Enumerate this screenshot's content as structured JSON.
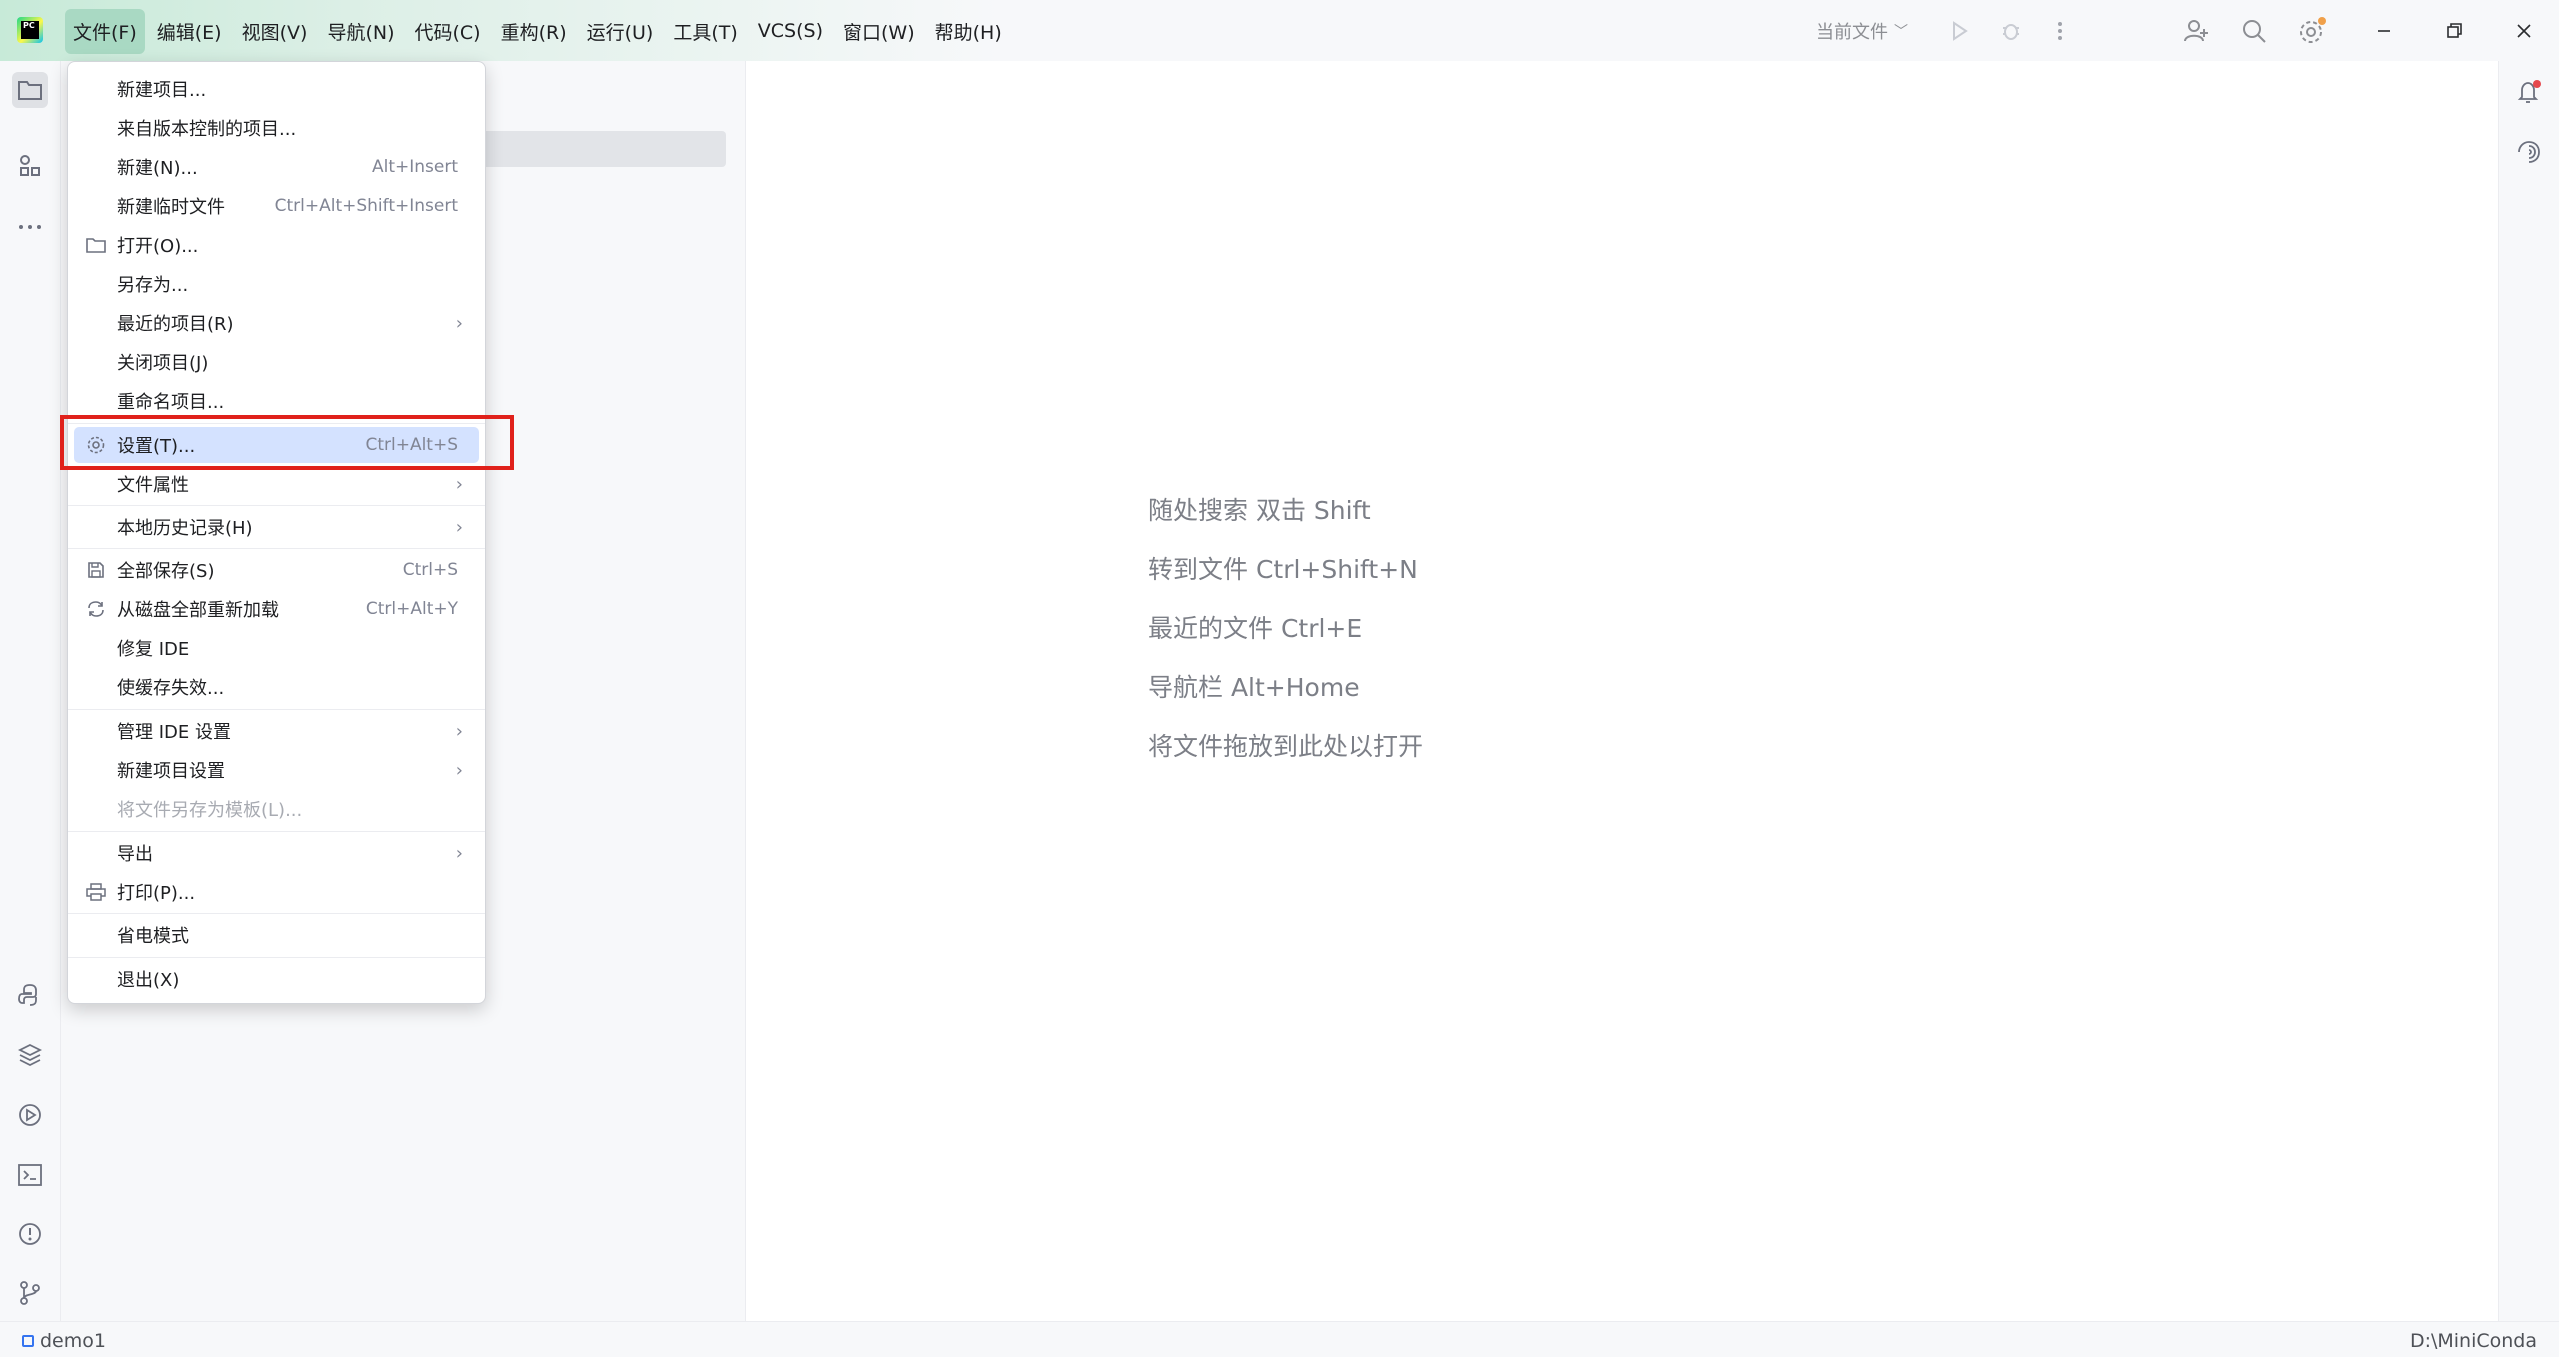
{
  "menubar": {
    "items": [
      "文件(F)",
      "编辑(E)",
      "视图(V)",
      "导航(N)",
      "代码(C)",
      "重构(R)",
      "运行(U)",
      "工具(T)",
      "VCS(S)",
      "窗口(W)",
      "帮助(H)"
    ],
    "active_index": 0
  },
  "toolbar": {
    "run_config": "当前文件"
  },
  "file_menu": {
    "items": [
      {
        "label": "新建项目...",
        "shortcut": "",
        "icon": "",
        "submenu": false
      },
      {
        "label": "来自版本控制的项目...",
        "shortcut": "",
        "icon": "",
        "submenu": false
      },
      {
        "label": "新建(N)...",
        "shortcut": "Alt+Insert",
        "icon": "",
        "submenu": false
      },
      {
        "label": "新建临时文件",
        "shortcut": "Ctrl+Alt+Shift+Insert",
        "icon": "",
        "submenu": false
      },
      {
        "label": "打开(O)...",
        "shortcut": "",
        "icon": "folder-icon",
        "submenu": false
      },
      {
        "label": "另存为...",
        "shortcut": "",
        "icon": "",
        "submenu": false
      },
      {
        "label": "最近的项目(R)",
        "shortcut": "",
        "icon": "",
        "submenu": true
      },
      {
        "label": "关闭项目(J)",
        "shortcut": "",
        "icon": "",
        "submenu": false
      },
      {
        "label": "重命名项目...",
        "shortcut": "",
        "icon": "",
        "submenu": false
      },
      {
        "label": "设置(T)...",
        "shortcut": "Ctrl+Alt+S",
        "icon": "gear-icon",
        "submenu": false,
        "highlighted": true
      },
      {
        "label": "文件属性",
        "shortcut": "",
        "icon": "",
        "submenu": true
      },
      {
        "label": "本地历史记录(H)",
        "shortcut": "",
        "icon": "",
        "submenu": true
      },
      {
        "label": "全部保存(S)",
        "shortcut": "Ctrl+S",
        "icon": "save-icon",
        "submenu": false
      },
      {
        "label": "从磁盘全部重新加载",
        "shortcut": "Ctrl+Alt+Y",
        "icon": "reload-icon",
        "submenu": false
      },
      {
        "label": "修复 IDE",
        "shortcut": "",
        "icon": "",
        "submenu": false
      },
      {
        "label": "使缓存失效...",
        "shortcut": "",
        "icon": "",
        "submenu": false
      },
      {
        "label": "管理 IDE 设置",
        "shortcut": "",
        "icon": "",
        "submenu": true
      },
      {
        "label": "新建项目设置",
        "shortcut": "",
        "icon": "",
        "submenu": true
      },
      {
        "label": "将文件另存为模板(L)...",
        "shortcut": "",
        "icon": "",
        "submenu": false,
        "disabled": true
      },
      {
        "label": "导出",
        "shortcut": "",
        "icon": "",
        "submenu": true
      },
      {
        "label": "打印(P)...",
        "shortcut": "",
        "icon": "print-icon",
        "submenu": false
      },
      {
        "label": "省电模式",
        "shortcut": "",
        "icon": "",
        "submenu": false
      },
      {
        "label": "退出(X)",
        "shortcut": "",
        "icon": "",
        "submenu": false
      }
    ]
  },
  "editor": {
    "hints": [
      "随处搜索 双击 Shift",
      "转到文件 Ctrl+Shift+N",
      "最近的文件 Ctrl+E",
      "导航栏 Alt+Home",
      "将文件拖放到此处以打开"
    ]
  },
  "statusbar": {
    "project": "demo1",
    "path": "D:\\MiniConda"
  },
  "colors": {
    "menu_highlight": "#d4e2ff",
    "annotation_box": "#e0211b",
    "active_menu_bg": "#a9d9c3"
  }
}
